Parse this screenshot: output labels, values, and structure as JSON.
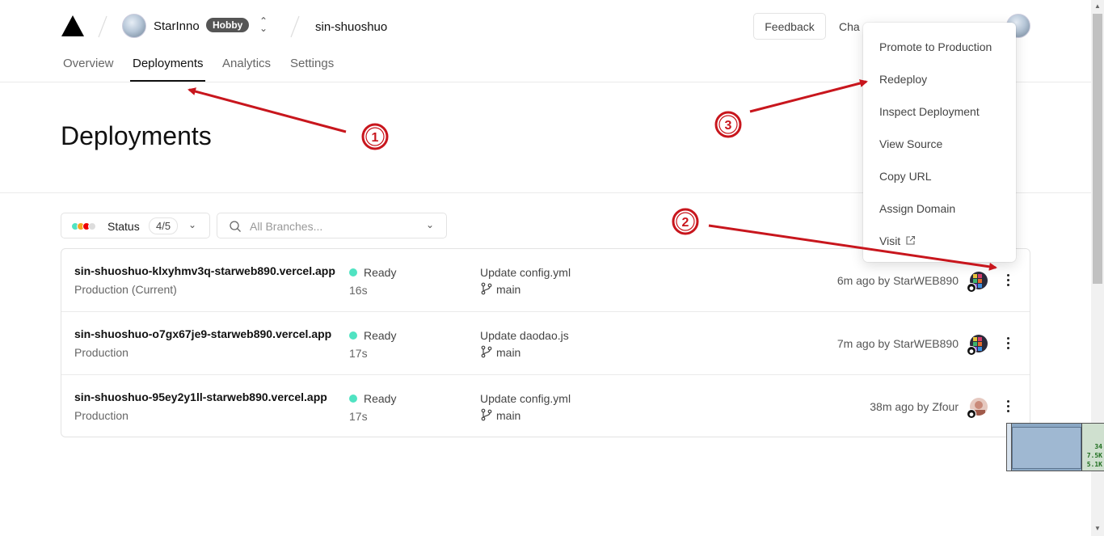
{
  "header": {
    "team_name": "StarInno",
    "plan_badge": "Hobby",
    "project_name": "sin-shuoshuo",
    "feedback_label": "Feedback",
    "changelog_label": "Cha"
  },
  "tabs": [
    {
      "label": "Overview",
      "active": false
    },
    {
      "label": "Deployments",
      "active": true
    },
    {
      "label": "Analytics",
      "active": false
    },
    {
      "label": "Settings",
      "active": false
    }
  ],
  "page": {
    "title": "Deployments"
  },
  "filters": {
    "status_label": "Status",
    "status_count": "4/5",
    "status_dot_colors": [
      "#50e3c2",
      "#f5a623",
      "#e00",
      "#ccc"
    ],
    "branch_placeholder": "All Branches..."
  },
  "deployments": [
    {
      "url": "sin-shuoshuo-klxyhmv3q-starweb890.vercel.app",
      "environment": "Production (Current)",
      "status": "Ready",
      "duration": "16s",
      "commit_message": "Update config.yml",
      "branch": "main",
      "time_author": "6m ago by StarWEB890"
    },
    {
      "url": "sin-shuoshuo-o7gx67je9-starweb890.vercel.app",
      "environment": "Production",
      "status": "Ready",
      "duration": "17s",
      "commit_message": "Update daodao.js",
      "branch": "main",
      "time_author": "7m ago by StarWEB890"
    },
    {
      "url": "sin-shuoshuo-95ey2y1ll-starweb890.vercel.app",
      "environment": "Production",
      "status": "Ready",
      "duration": "17s",
      "commit_message": "Update config.yml",
      "branch": "main",
      "time_author": "38m ago by Zfour"
    }
  ],
  "menu": {
    "items": [
      "Promote to Production",
      "Redeploy",
      "Inspect Deployment",
      "View Source",
      "Copy URL",
      "Assign Domain",
      "Visit"
    ]
  },
  "annotations": {
    "color": "#c8161d",
    "markers": [
      "①",
      "②",
      "③"
    ]
  },
  "widget": {
    "values": [
      "34",
      "7.5K",
      "5.1K"
    ]
  },
  "colors": {
    "ready": "#50e3c2",
    "accent": "#111111"
  }
}
